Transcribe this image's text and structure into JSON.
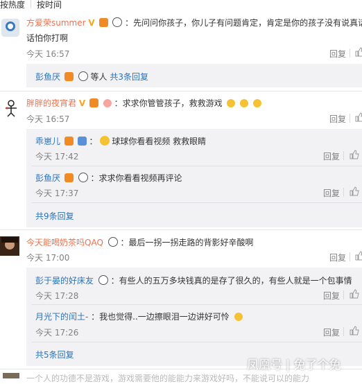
{
  "tabs": {
    "by_heat": "按热度",
    "by_time": "按时间"
  },
  "comments": [
    {
      "user": "方爱荣summer",
      "text_line1": "：先问问你孩子，你儿子有问题肯定，肯定是你的孩子没有说真话，",
      "text_line2": "话怕你打啊",
      "time": "今天 16:57",
      "reply": "回复",
      "thread_user": "彭鱼厌",
      "thread_text": "等人",
      "thread_link": "共3条回复"
    },
    {
      "user": "胖胖的夜宵君",
      "text": "：求求你管管孩子，救救游戏",
      "time": "今天 16:57",
      "reply": "回复",
      "replies": [
        {
          "user": "乖崽儿",
          "text": "球球你看看视频 救救眼睛",
          "time": "今天 17:42",
          "reply": "回复"
        },
        {
          "user": "彭鱼厌",
          "text": "：求求你看看视频再评论",
          "time": "今天 17:37",
          "reply": "回复"
        }
      ],
      "more": "共9条回复"
    },
    {
      "user": "今天能喝奶茶吗QAQ",
      "text": "：最后一拐一拐走路的背影好辛酸啊",
      "time": "今天 17:00",
      "reply": "回复",
      "replies": [
        {
          "user": "彭于晏的好床友",
          "text": "：有些人的五万多块钱真的是存了很久的，有些人就是一个包事情",
          "time": "今天 17:28",
          "reply": "回复"
        },
        {
          "user": "月光下的闰土-",
          "text": "：我也觉得..一边擦眼泪一边讲好可怜",
          "time": "今天 17:26",
          "reply": "回复"
        }
      ],
      "more": "共5条回复"
    }
  ],
  "bottom_fragment": "一个人的功德不是游戏，游戏需要他的能能力来游戏好吗，不能说可以的能力",
  "watermark": "凤凰号 | 免了个免",
  "colors": {
    "name": "#eb7350",
    "link": "#2b73b8",
    "sub_bg": "#f2f2f5",
    "gray": "#808080"
  }
}
